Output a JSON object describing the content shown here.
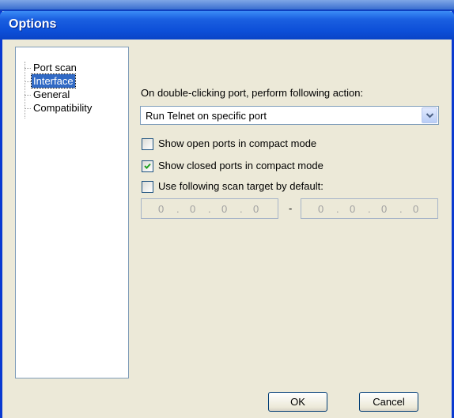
{
  "window": {
    "title": "Options"
  },
  "tree": {
    "items": [
      {
        "label": "Port scan",
        "selected": false
      },
      {
        "label": "Interface",
        "selected": true
      },
      {
        "label": "General",
        "selected": false
      },
      {
        "label": "Compatibility",
        "selected": false
      }
    ]
  },
  "interface": {
    "action_label": "On double-clicking port, perform following action:",
    "action_select_value": "Run Telnet on specific port",
    "open_compact_label": "Show open ports in compact mode",
    "open_compact_checked": false,
    "closed_compact_label": "Show closed ports in compact mode",
    "closed_compact_checked": true,
    "default_target_label": "Use following scan target by default:",
    "default_target_checked": false,
    "ip_from": [
      "0",
      "0",
      "0",
      "0"
    ],
    "ip_to": [
      "0",
      "0",
      "0",
      "0"
    ],
    "ip_separator": "-"
  },
  "buttons": {
    "ok_label": "OK",
    "cancel_label": "Cancel"
  },
  "icons": {
    "dropdown": "chevron-down-icon",
    "check": "checkmark-icon"
  },
  "colors": {
    "titlebar": "#0a44c6",
    "selection": "#316ac5",
    "face": "#ece9d8"
  }
}
